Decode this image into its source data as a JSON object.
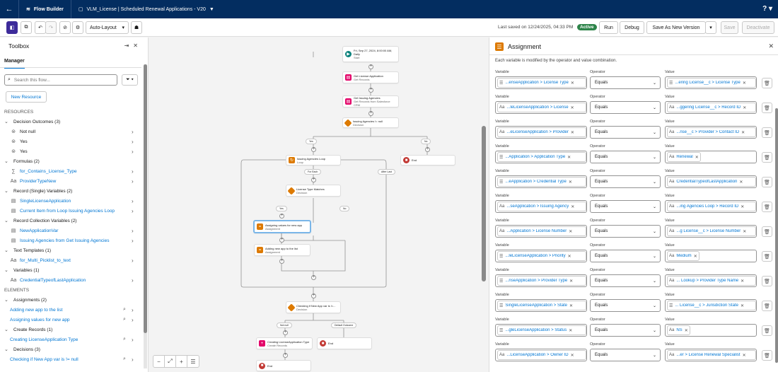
{
  "topbar": {
    "app_name": "Flow Builder",
    "flow_title": "VLM_License | Scheduled Renewal Applications - V20",
    "help": "?"
  },
  "toolbar": {
    "layout_mode": "Auto-Layout",
    "saved_text": "Last saved on 12/24/2025, 04:33 PM",
    "status": "Active",
    "run": "Run",
    "debug": "Debug",
    "save_as": "Save As New Version",
    "save": "Save",
    "deactivate": "Deactivate"
  },
  "toolbox": {
    "title": "Toolbox",
    "tab": "Manager",
    "search_placeholder": "Search this flow...",
    "new_resource": "New Resource",
    "resources_label": "RESOURCES",
    "elements_label": "ELEMENTS",
    "resources": [
      {
        "group": "Decision Outcomes (3)",
        "items": [
          {
            "label": "Not null",
            "icon": "⊜"
          },
          {
            "label": "Yes",
            "icon": "⊜"
          },
          {
            "label": "Yes",
            "icon": "⊜"
          }
        ]
      },
      {
        "group": "Formulas (2)",
        "items": [
          {
            "label": "for_Contains_License_Type",
            "icon": "∑"
          },
          {
            "label": "ProviderTypeNew",
            "icon": "Aa"
          }
        ]
      },
      {
        "group": "Record (Single) Variables (2)",
        "items": [
          {
            "label": "SingleLicenseApplication",
            "icon": "▤"
          },
          {
            "label": "Current Item from Loop Issuing Agencies Loop",
            "icon": "▤"
          }
        ]
      },
      {
        "group": "Record Collection Variables (2)",
        "items": [
          {
            "label": "NewApplicationVar",
            "icon": "▤"
          },
          {
            "label": "Issuing Agencies from Get Issuing Agencies",
            "icon": "▤"
          }
        ]
      },
      {
        "group": "Text Templates (1)",
        "items": [
          {
            "label": "for_Multi_Picklist_to_text",
            "icon": "Aa"
          }
        ]
      },
      {
        "group": "Variables (1)",
        "items": [
          {
            "label": "CredentialTypeofLastApplication",
            "icon": "Aa"
          }
        ]
      }
    ],
    "elements": [
      {
        "group": "Assignments (2)",
        "items": [
          "Adding new app to the list",
          "Assigning values for new app"
        ]
      },
      {
        "group": "Create Records (1)",
        "items": [
          "Creating LicenseApplication Type"
        ]
      },
      {
        "group": "Decisions (3)",
        "items": [
          "Checking if New App var is != null"
        ]
      }
    ]
  },
  "canvas": {
    "nodes": {
      "start": {
        "title": "Fri, Sep 27, 2024, 8:00:00 AM,",
        "line2": "Daily",
        "sub": "Start"
      },
      "get_license": {
        "title": "Get License Application",
        "sub": "Get Records"
      },
      "get_agencies": {
        "title": "Get Issuing Agencies",
        "sub": "Get Records from Salesforce CRM"
      },
      "dec_agencies": {
        "title": "Issuing Agencies != null",
        "sub": "Decision"
      },
      "loop": {
        "title": "Issuing Agencies Loop",
        "sub": "Loop"
      },
      "end1": {
        "title": "End"
      },
      "dec_type": {
        "title": "License Type Matches",
        "sub": "Decision"
      },
      "assign_values": {
        "title": "Assigning values for new app",
        "sub": "Assignment"
      },
      "add_app": {
        "title": "Adding new app to the list",
        "sub": "Assignment"
      },
      "dec_null": {
        "title": "Checking if New App var is !=...",
        "sub": "Decision"
      },
      "create": {
        "title": "Creating LicenseApplication Type",
        "sub": "Create Records"
      },
      "end2": {
        "title": "End"
      },
      "end3": {
        "title": "End"
      }
    },
    "pills": {
      "yes": "Yes",
      "no": "No",
      "for_each": "For Each",
      "after_last": "After Last",
      "yes2": "Yes",
      "no2": "No",
      "not_null": "Not null",
      "default": "Default Outcome"
    }
  },
  "panel": {
    "title": "Assignment",
    "description": "Each variable is modified by the operator and value combination.",
    "labels": {
      "variable": "Variable",
      "operator": "Operator",
      "value": "Value"
    },
    "rows": [
      {
        "var": "...enseApplication > License Type",
        "var_icon": "list",
        "op": "Equals",
        "val": "...ering License__c > License Type",
        "val_icon": "list"
      },
      {
        "var": "...leLicenseApplication > License",
        "var_icon": "text",
        "op": "Equals",
        "val": "...ggering License__c > Record ID",
        "val_icon": "text"
      },
      {
        "var": "...eLicenseApplication > Provider",
        "var_icon": "text",
        "op": "Equals",
        "val": "...nse__c > Provider > Contact ID",
        "val_icon": "text"
      },
      {
        "var": "...Application > Application Type",
        "var_icon": "list",
        "op": "Equals",
        "val": "Renewal",
        "val_icon": "text",
        "val_short": true
      },
      {
        "var": "...eApplication > Credential Type",
        "var_icon": "list",
        "op": "Equals",
        "val": "CredentialTypeofLastApplication",
        "val_icon": "text"
      },
      {
        "var": "...seApplication > Issuing Agency",
        "var_icon": "text",
        "op": "Equals",
        "val": "...ing Agencies Loop > Record ID",
        "val_icon": "text"
      },
      {
        "var": "...Application > License Number",
        "var_icon": "text",
        "op": "Equals",
        "val": "...g License__c > License Number",
        "val_icon": "text"
      },
      {
        "var": "...leLicenseApplication > Priority",
        "var_icon": "list",
        "op": "Equals",
        "val": "Medium",
        "val_icon": "text",
        "val_short": true
      },
      {
        "var": "...nseApplication > Provider Type",
        "var_icon": "list",
        "op": "Equals",
        "val": "... Lookup > Provider Type Name",
        "val_icon": "text"
      },
      {
        "var": "SingleLicenseApplication > State",
        "var_icon": "list",
        "op": "Equals",
        "val": "... License__c > Jurisdiction State",
        "val_icon": "list"
      },
      {
        "var": "...gleLicenseApplication > Status",
        "var_icon": "list",
        "op": "Equals",
        "val": "NS",
        "val_icon": "text",
        "val_short": true
      },
      {
        "var": "...LicenseApplication > Owner ID",
        "var_icon": "text",
        "op": "Equals",
        "val": "...er > License Renewal Specialist",
        "val_icon": "text"
      }
    ]
  },
  "colors": {
    "topbar": "#032d60",
    "brand_blue": "#0176d3",
    "active_green": "#2e844a",
    "decision_orange": "#dd7a01",
    "record_pink": "#e3066a",
    "end_red": "#c23934"
  }
}
